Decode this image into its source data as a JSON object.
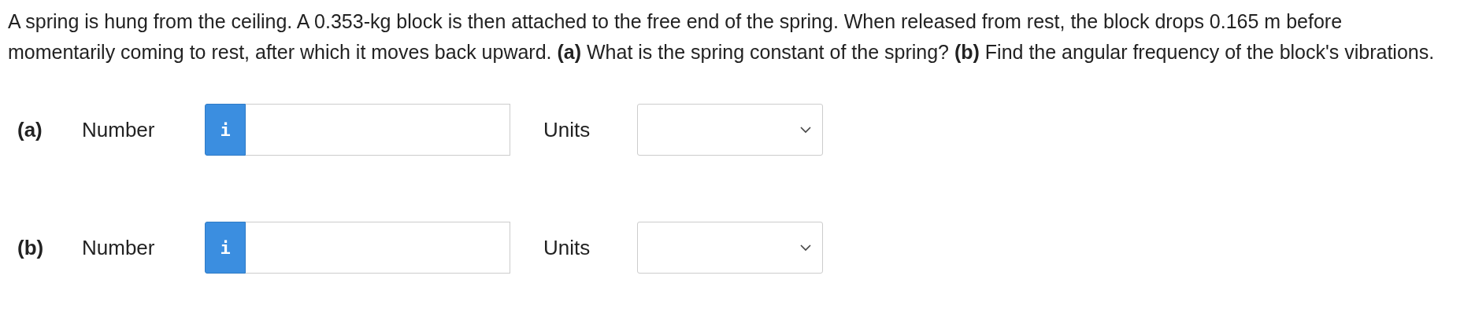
{
  "question": {
    "text": "A spring is hung from the ceiling. A 0.353-kg block is then attached to the free end of the spring. When released from rest, the block drops 0.165 m before momentarily coming to rest, after which it moves back upward. **(a)** What is the spring constant of the spring? **(b)** Find the angular frequency of the block's vibrations."
  },
  "parts": [
    {
      "label": "(a)",
      "number_label": "Number",
      "info": "i",
      "units_label": "Units"
    },
    {
      "label": "(b)",
      "number_label": "Number",
      "info": "i",
      "units_label": "Units"
    }
  ]
}
